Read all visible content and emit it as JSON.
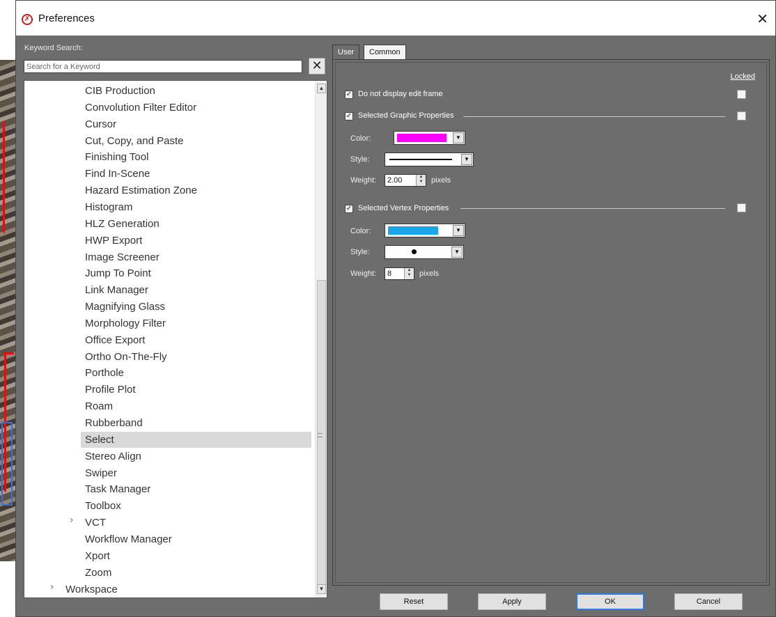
{
  "window": {
    "title": "Preferences"
  },
  "search": {
    "label": "Keyword Search:",
    "placeholder": "Search for a Keyword",
    "value": ""
  },
  "tree": {
    "items": [
      {
        "label": "CIB Production",
        "depth": 2
      },
      {
        "label": "Convolution Filter Editor",
        "depth": 2
      },
      {
        "label": "Cursor",
        "depth": 2
      },
      {
        "label": "Cut, Copy, and Paste",
        "depth": 2
      },
      {
        "label": "Finishing Tool",
        "depth": 2
      },
      {
        "label": "Find In-Scene",
        "depth": 2
      },
      {
        "label": "Hazard Estimation Zone",
        "depth": 2
      },
      {
        "label": "Histogram",
        "depth": 2
      },
      {
        "label": "HLZ Generation",
        "depth": 2
      },
      {
        "label": "HWP Export",
        "depth": 2
      },
      {
        "label": "Image Screener",
        "depth": 2
      },
      {
        "label": "Jump To Point",
        "depth": 2
      },
      {
        "label": "Link Manager",
        "depth": 2
      },
      {
        "label": "Magnifying Glass",
        "depth": 2
      },
      {
        "label": "Morphology Filter",
        "depth": 2
      },
      {
        "label": "Office Export",
        "depth": 2
      },
      {
        "label": "Ortho On-The-Fly",
        "depth": 2
      },
      {
        "label": "Porthole",
        "depth": 2
      },
      {
        "label": "Profile Plot",
        "depth": 2
      },
      {
        "label": "Roam",
        "depth": 2
      },
      {
        "label": "Rubberband",
        "depth": 2
      },
      {
        "label": "Select",
        "depth": 2,
        "selected": true
      },
      {
        "label": "Stereo Align",
        "depth": 2
      },
      {
        "label": "Swiper",
        "depth": 2
      },
      {
        "label": "Task Manager",
        "depth": 2
      },
      {
        "label": "Toolbox",
        "depth": 2
      },
      {
        "label": "VCT",
        "depth": 2,
        "expandable": true
      },
      {
        "label": "Workflow Manager",
        "depth": 2
      },
      {
        "label": "Xport",
        "depth": 2
      },
      {
        "label": "Zoom",
        "depth": 2
      },
      {
        "label": "Workspace",
        "depth": 1,
        "expandable": true
      }
    ]
  },
  "tabs": [
    {
      "label": "User",
      "active": true
    },
    {
      "label": "Common",
      "active": false
    }
  ],
  "panel": {
    "locked_label": "Locked",
    "do_not_display": {
      "label": "Do not display edit frame",
      "checked": true
    },
    "graphic": {
      "label": "Selected Graphic Properties",
      "checked": true,
      "color_label": "Color:",
      "color": "#ff00ff",
      "style_label": "Style:",
      "style": "solid-line",
      "weight_label": "Weight:",
      "weight": "2.00",
      "unit": "pixels"
    },
    "vertex": {
      "label": "Selected Vertex Properties",
      "checked": true,
      "color_label": "Color:",
      "color": "#1aa6e8",
      "style_label": "Style:",
      "style": "dot",
      "weight_label": "Weight:",
      "weight": "8",
      "unit": "pixels"
    }
  },
  "buttons": {
    "reset": "Reset",
    "apply": "Apply",
    "ok": "OK",
    "cancel": "Cancel"
  }
}
